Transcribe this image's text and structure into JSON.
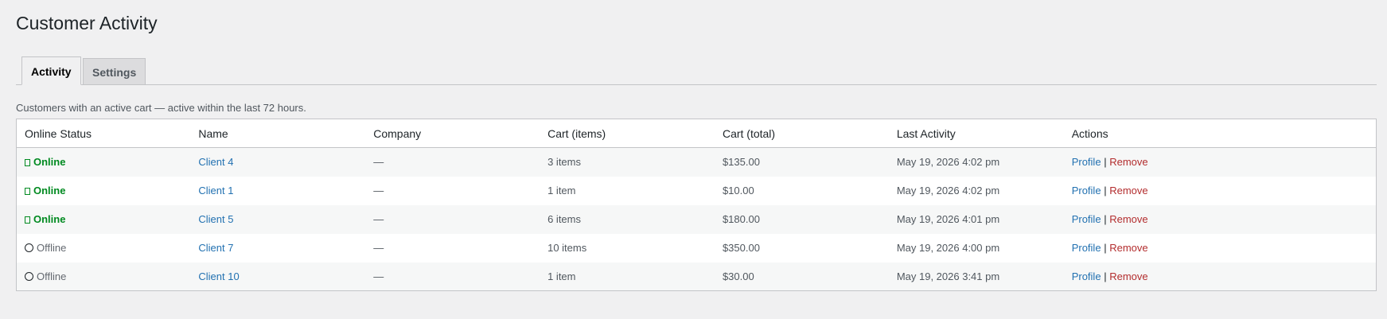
{
  "page": {
    "title": "Customer Activity",
    "description": "Customers with an active cart — active within the last 72 hours."
  },
  "tabs": [
    {
      "label": "Activity",
      "active": true
    },
    {
      "label": "Settings",
      "active": false
    }
  ],
  "table": {
    "columns": [
      "Online Status",
      "Name",
      "Company",
      "Cart (items)",
      "Cart (total)",
      "Last Activity",
      "Actions"
    ],
    "rows": [
      {
        "status": "Online",
        "online": true,
        "name": "Client 4",
        "company": "—",
        "items": "3 items",
        "total": "$135.00",
        "last": "May 19, 2026 4:02 pm"
      },
      {
        "status": "Online",
        "online": true,
        "name": "Client 1",
        "company": "—",
        "items": "1 item",
        "total": "$10.00",
        "last": "May 19, 2026 4:02 pm"
      },
      {
        "status": "Online",
        "online": true,
        "name": "Client 5",
        "company": "—",
        "items": "6 items",
        "total": "$180.00",
        "last": "May 19, 2026 4:01 pm"
      },
      {
        "status": "Offline",
        "online": false,
        "name": "Client 7",
        "company": "—",
        "items": "10 items",
        "total": "$350.00",
        "last": "May 19, 2026 4:00 pm"
      },
      {
        "status": "Offline",
        "online": false,
        "name": "Client 10",
        "company": "—",
        "items": "1 item",
        "total": "$30.00",
        "last": "May 19, 2026 3:41 pm"
      }
    ],
    "actions": {
      "profile": "Profile",
      "separator": "|",
      "remove": "Remove"
    }
  },
  "colors": {
    "online": "#008a20",
    "link": "#2271b1",
    "remove": "#b32d2e",
    "background": "#f0f0f1"
  },
  "icons": {
    "online": "online-indicator-icon",
    "offline": "offline-circle-icon"
  }
}
